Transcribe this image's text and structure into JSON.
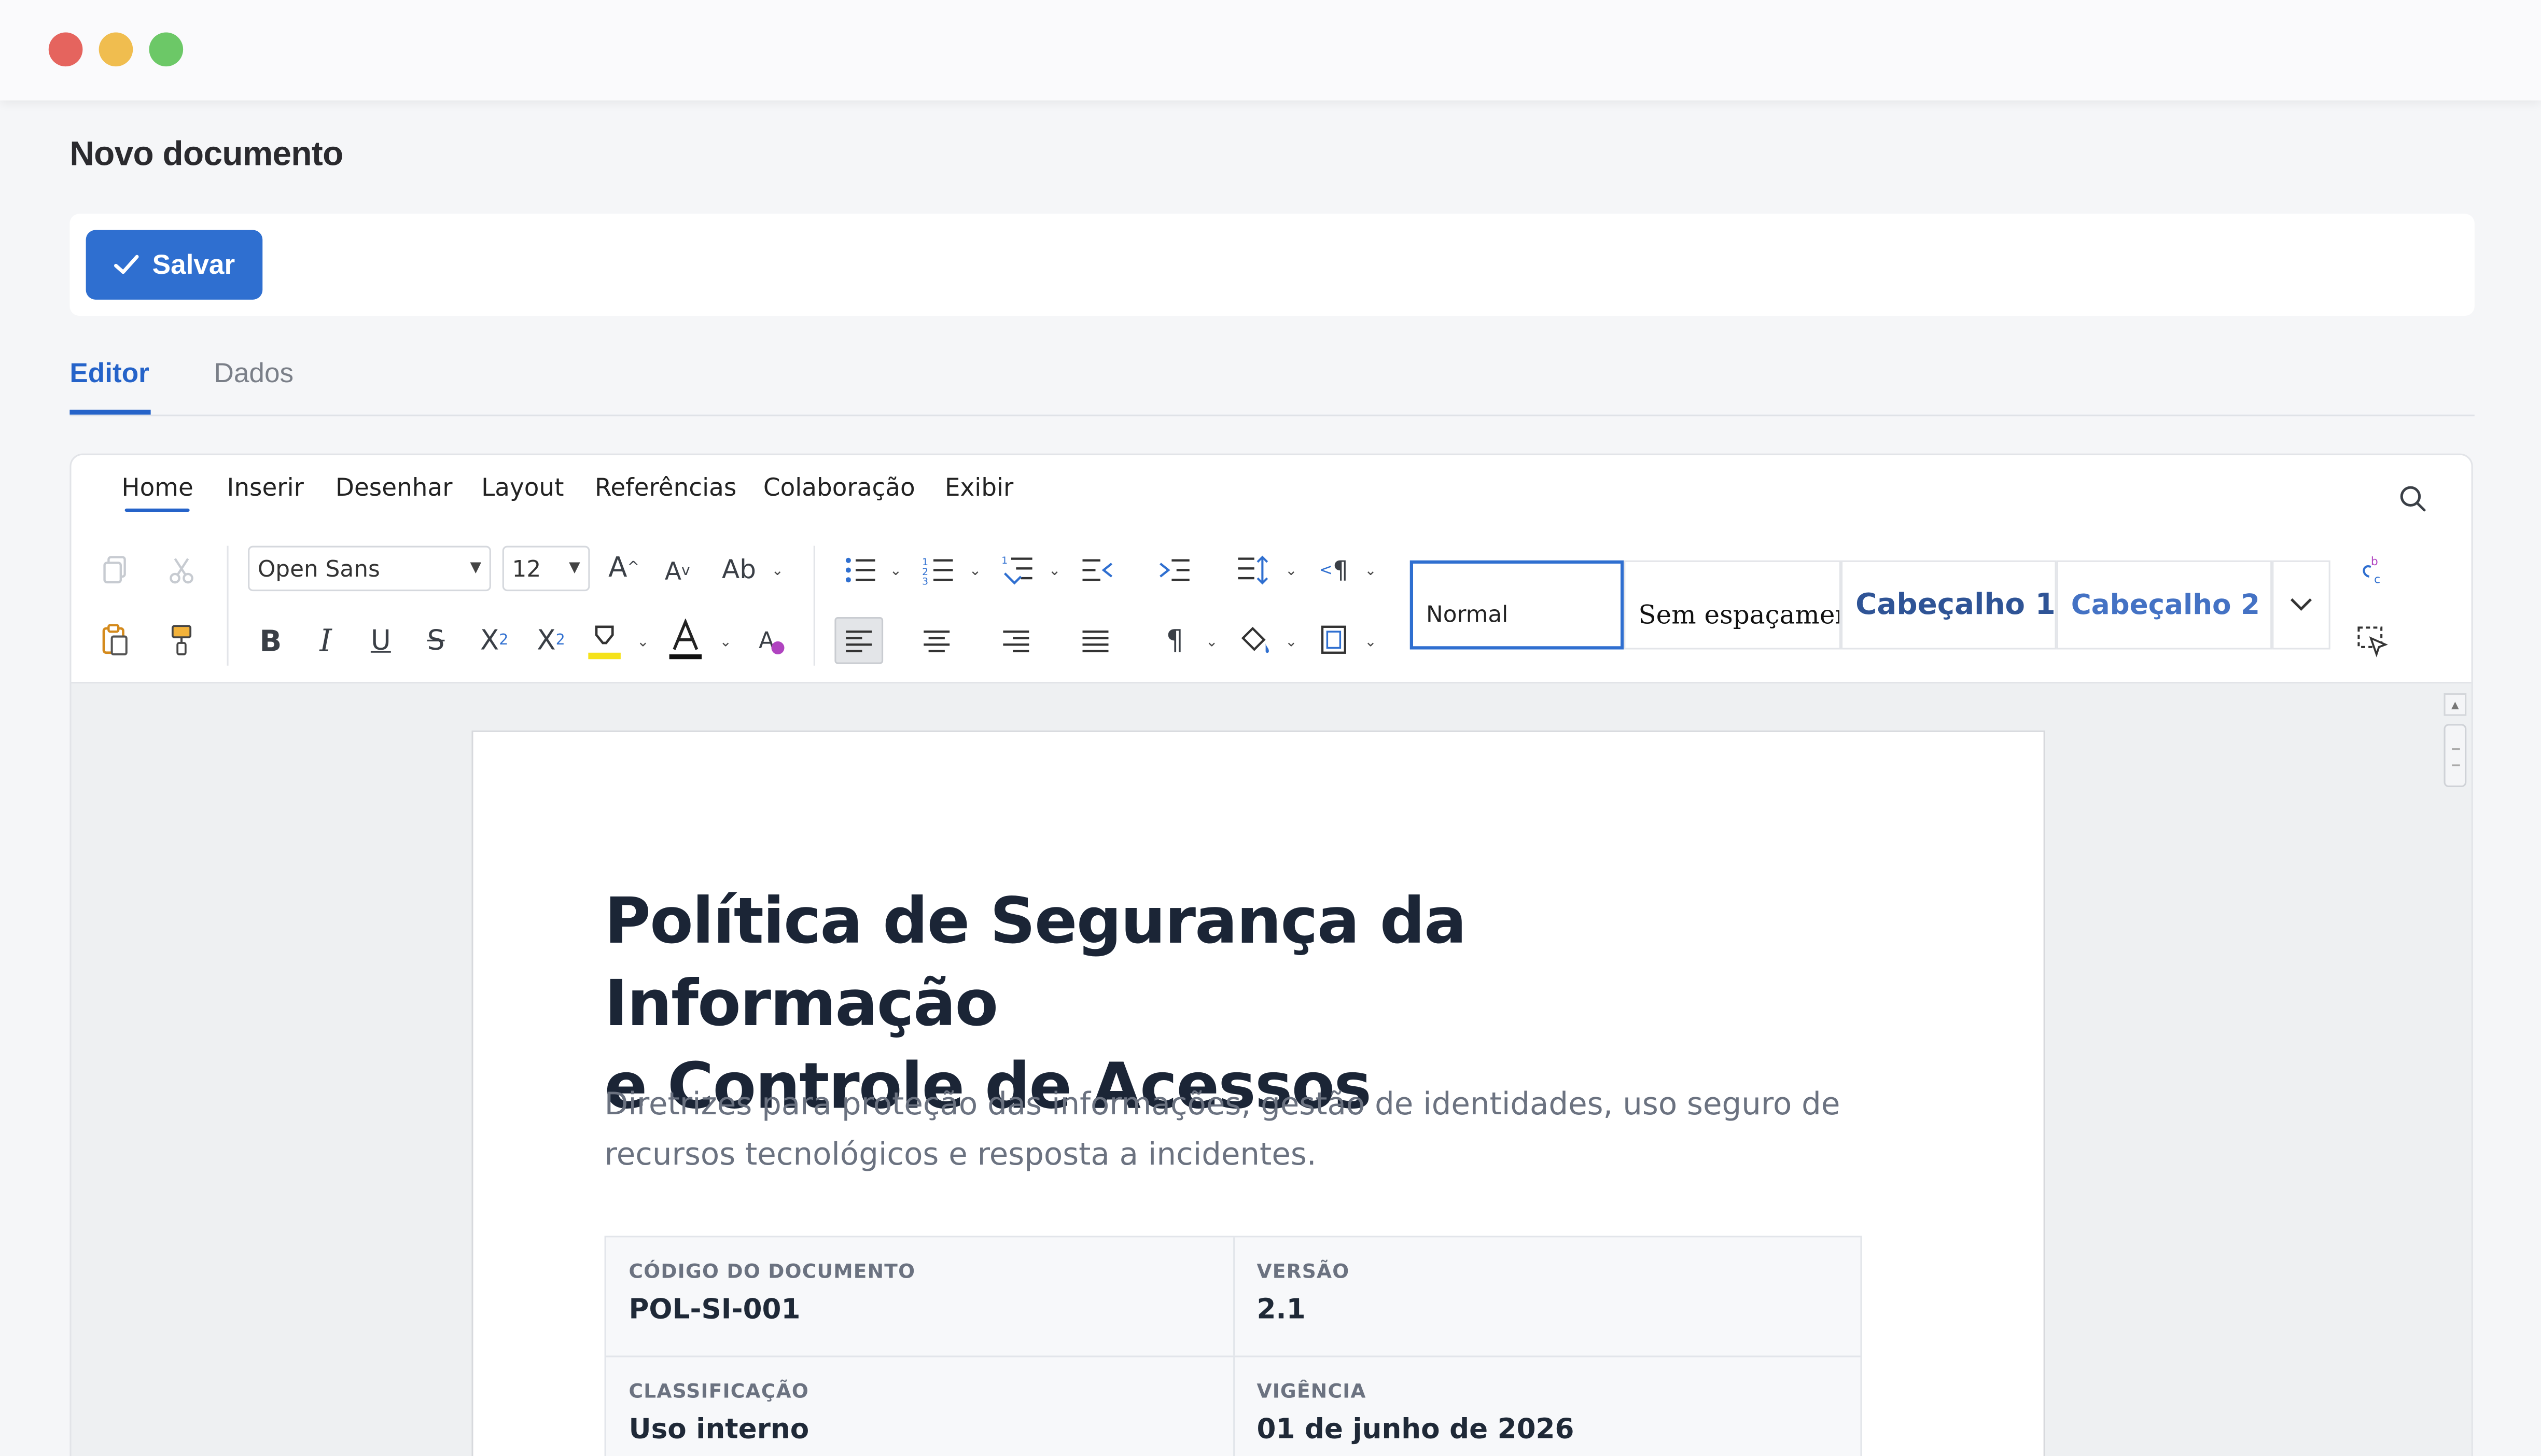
{
  "window": {
    "controls": [
      "close",
      "minimize",
      "maximize"
    ]
  },
  "page": {
    "title": "Novo documento"
  },
  "toolbar": {
    "save_label": "Salvar",
    "save_icon": "check-icon"
  },
  "tabs": [
    {
      "label": "Editor",
      "active": true
    },
    {
      "label": "Dados",
      "active": false
    }
  ],
  "ribbon": {
    "menu": [
      "Home",
      "Inserir",
      "Desenhar",
      "Layout",
      "Referências",
      "Colaboração",
      "Exibir"
    ],
    "active_menu": "Home",
    "font_name": "Open Sans",
    "font_size": "12",
    "styles": [
      "Normal",
      "Sem espaçamer",
      "Cabeçalho 1",
      "Cabeçalho 2"
    ],
    "selected_style": "Normal",
    "colors": {
      "accent": "#2f6fd0",
      "highlight": "#f5e21a",
      "heading": "#2f5496",
      "heading2": "#4472c4"
    }
  },
  "document": {
    "title_line1": "Política de Segurança da Informação",
    "title_line2": "e Controle de Acessos",
    "subtitle": "Diretrizes para proteção das informações, gestão de identidades, uso seguro de recursos tecnológicos e resposta a incidentes.",
    "meta": [
      [
        {
          "label": "CÓDIGO DO DOCUMENTO",
          "value": "POL-SI-001"
        },
        {
          "label": "VERSÃO",
          "value": "2.1"
        }
      ],
      [
        {
          "label": "CLASSIFICAÇÃO",
          "value": "Uso interno"
        },
        {
          "label": "VIGÊNCIA",
          "value": "01 de junho de 2026"
        }
      ]
    ]
  }
}
